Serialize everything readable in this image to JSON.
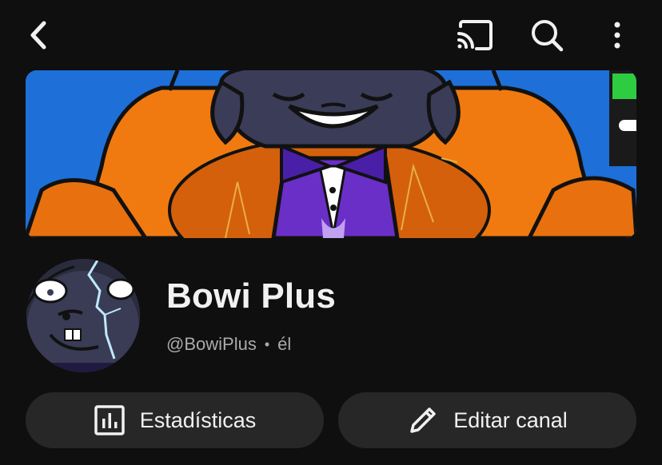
{
  "header": {
    "back_icon": "chevron-left-icon",
    "cast_icon": "cast-icon",
    "search_icon": "search-icon",
    "more_icon": "more-vertical-icon"
  },
  "channel": {
    "name": "Bowi Plus",
    "handle": "@BowiPlus",
    "separator": "•",
    "pronoun": "él"
  },
  "actions": {
    "stats_label": "Estadísticas",
    "stats_icon": "analytics-icon",
    "edit_label": "Editar canal",
    "edit_icon": "pencil-icon"
  },
  "colors": {
    "background": "#0f0f0f",
    "button_bg": "#272727",
    "text_primary": "#f1f1f1",
    "text_secondary": "#aaaaaa"
  }
}
